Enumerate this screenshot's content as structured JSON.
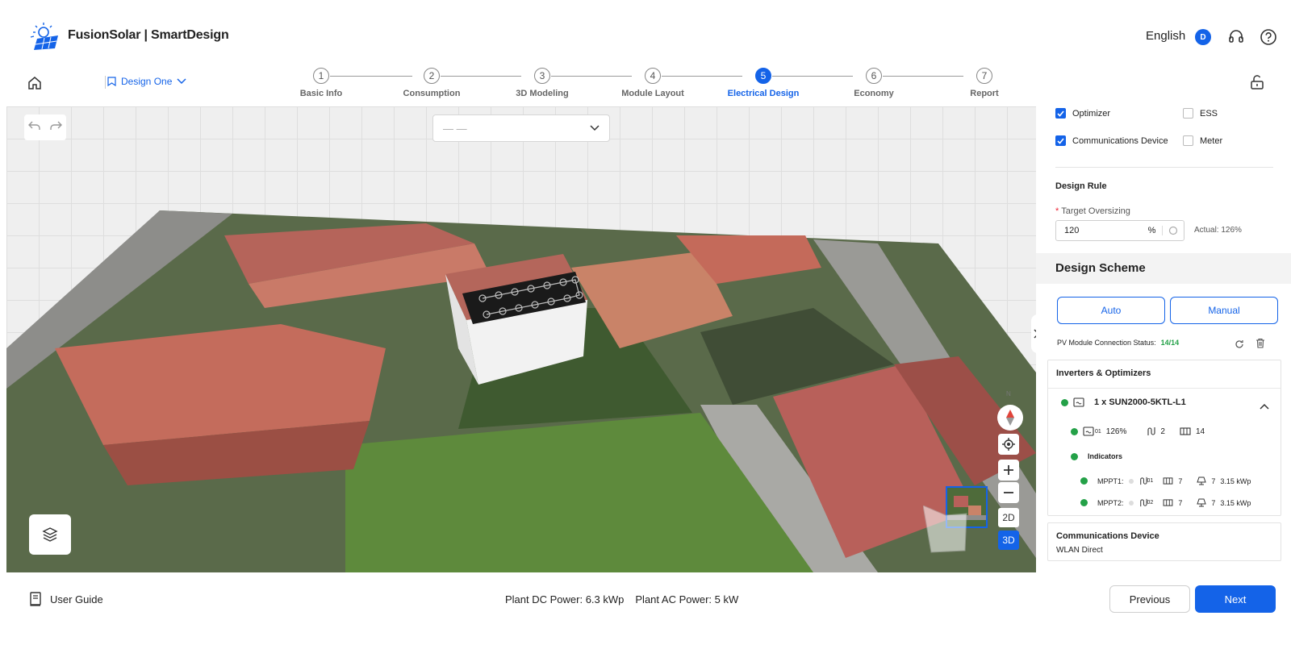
{
  "app": {
    "title": "FusionSolar | SmartDesign"
  },
  "header": {
    "language": "English",
    "user_initial": "D"
  },
  "design": {
    "name": "Design One"
  },
  "steps": [
    {
      "num": "1",
      "label": "Basic Info"
    },
    {
      "num": "2",
      "label": "Consumption"
    },
    {
      "num": "3",
      "label": "3D Modeling"
    },
    {
      "num": "4",
      "label": "Module Layout"
    },
    {
      "num": "5",
      "label": "Electrical Design"
    },
    {
      "num": "6",
      "label": "Economy"
    },
    {
      "num": "7",
      "label": "Report"
    }
  ],
  "active_step": "5",
  "map": {
    "selector_value": "— —",
    "compass_label": "N",
    "btn_2d": "2D",
    "btn_3d": "3D",
    "view_mode": "3D"
  },
  "panel": {
    "devices": [
      {
        "label": "Optimizer",
        "checked": true
      },
      {
        "label": "ESS",
        "checked": false
      },
      {
        "label": "Communications Device",
        "checked": true
      },
      {
        "label": "Meter",
        "checked": false
      }
    ],
    "design_rule_title": "Design Rule",
    "target_oversizing_label": "Target Oversizing",
    "target_oversizing_value": "120",
    "target_oversizing_unit": "%",
    "actual_label": "Actual: 126%",
    "design_scheme_title": "Design Scheme",
    "auto_label": "Auto",
    "manual_label": "Manual",
    "connection_status_label": "PV Module Connection Status:",
    "connection_status_value": "14/14",
    "inverters_title": "Inverters & Optimizers",
    "inverter": {
      "name": "1 x SUN2000-5KTL-L1",
      "index_sup": "01",
      "ratio": "126%",
      "strings": "2",
      "modules": "14"
    },
    "indicators_label": "Indicators",
    "mppts": [
      {
        "label": "MPPT1:",
        "sup": "01",
        "modules": "7",
        "panels": "7",
        "power": "3.15 kWp"
      },
      {
        "label": "MPPT2:",
        "sup": "02",
        "modules": "7",
        "panels": "7",
        "power": "3.15 kWp"
      }
    ],
    "comm_device_title": "Communications Device",
    "comm_device_value": "WLAN Direct"
  },
  "footer": {
    "user_guide": "User Guide",
    "plant_dc": "Plant DC Power: 6.3 kWp",
    "plant_ac": "Plant AC Power: 5 kW",
    "previous": "Previous",
    "next": "Next"
  },
  "colors": {
    "accent": "#1463e8",
    "ok": "#24a148"
  }
}
